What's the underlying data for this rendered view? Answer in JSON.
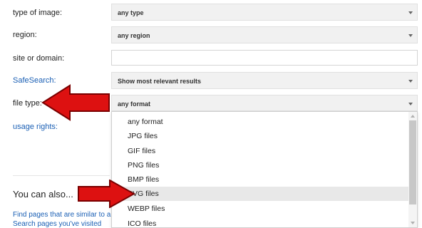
{
  "form": {
    "type_of_image": {
      "label": "type of image:",
      "value": "any type"
    },
    "region": {
      "label": "region:",
      "value": "any region"
    },
    "site_or_domain": {
      "label": "site or domain:",
      "value": ""
    },
    "safesearch": {
      "label": "SafeSearch:",
      "value": "Show most relevant results"
    },
    "file_type": {
      "label": "file type:",
      "value": "any format"
    },
    "usage_rights": {
      "label": "usage rights:"
    }
  },
  "dropdown": {
    "options": [
      "any format",
      "JPG files",
      "GIF files",
      "PNG files",
      "BMP files",
      "SVG files",
      "WEBP files",
      "ICO files"
    ],
    "highlighted": "SVG files"
  },
  "you_can_also": {
    "heading": "You can also...",
    "links": [
      "Find pages that are similar to a",
      "Search pages you've visited"
    ]
  },
  "colors": {
    "arrow": "#dd1111",
    "link": "#1a5fb4"
  }
}
